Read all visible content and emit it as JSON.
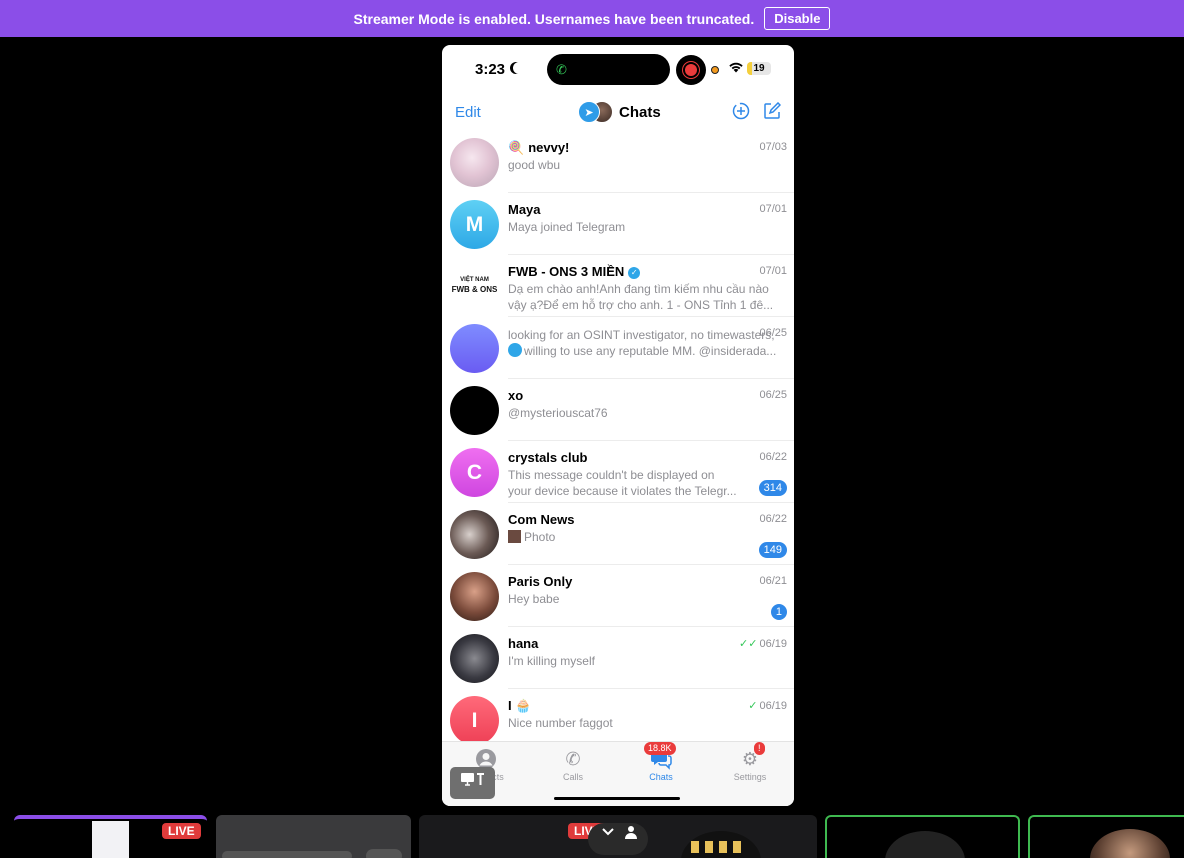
{
  "banner": {
    "text": "Streamer Mode is enabled. Usernames have been truncated.",
    "button": "Disable"
  },
  "status": {
    "time": "3:23",
    "battery": "19",
    "battery_level": 0.19
  },
  "nav": {
    "edit": "Edit",
    "title": "Chats"
  },
  "chats": [
    {
      "name": "nevvy!",
      "name_prefix": "🍭",
      "date": "07/03",
      "preview": [
        "good wbu"
      ],
      "avatar": "photo-pastel",
      "badge": ""
    },
    {
      "name": "Maya",
      "date": "07/01",
      "preview": [
        "Maya joined Telegram"
      ],
      "avatar_letter": "M",
      "avatar": "cyan",
      "badge": ""
    },
    {
      "name": "FWB - ONS 3 MIỀN",
      "verified": true,
      "date": "07/01",
      "preview": [
        "Dạ em chào anh!Anh đang tìm kiếm nhu cầu nào",
        "vậy ạ?Để em hỗ trợ cho anh. 1 - ONS Tỉnh 1 đê..."
      ],
      "avatar_text": "FWB & ONS",
      "avatar_small": "VIỆT NAM",
      "avatar": "fwb",
      "badge": ""
    },
    {
      "name": "",
      "date": "06/25",
      "preview": [
        "looking for an OSINT investigator, no timewasters,",
        "willing to use any reputable MM. @insiderada..."
      ],
      "avatar": "violet",
      "badge": ""
    },
    {
      "name": "xo",
      "date": "06/25",
      "preview": [
        "@mysteriouscat76"
      ],
      "avatar": "black",
      "badge": ""
    },
    {
      "name": "crystals club",
      "date": "06/22",
      "preview": [
        "This message couldn't be displayed on",
        "your device because it violates the Telegr..."
      ],
      "avatar_letter": "C",
      "avatar": "magenta",
      "badge": "314"
    },
    {
      "name": "Com News",
      "date": "06/22",
      "preview": [
        "Photo"
      ],
      "avatar": "photo-bw",
      "badge": "149"
    },
    {
      "name": "Paris Only",
      "date": "06/21",
      "preview": [
        "Hey babe"
      ],
      "avatar": "photo-warm",
      "badge": "1"
    },
    {
      "name": "hana",
      "date": "06/19",
      "read": "✓✓",
      "preview": [
        "I'm killing myself"
      ],
      "avatar": "photo-dark",
      "badge": ""
    },
    {
      "name": "I",
      "name_suffix": "🧁",
      "date": "06/19",
      "read": "✓",
      "preview": [
        "Nice number faggot"
      ],
      "avatar_letter": "I",
      "avatar": "red",
      "badge": ""
    }
  ],
  "tabs": [
    {
      "label": "Contacts",
      "icon": "person-icon"
    },
    {
      "label": "Calls",
      "icon": "phone-icon"
    },
    {
      "label": "Chats",
      "icon": "chat-bubbles-icon",
      "badge": "18.8K",
      "active": true
    },
    {
      "label": "Settings",
      "icon": "gear-icon",
      "badge": "!"
    }
  ],
  "thumbs": {
    "live": "LIVE"
  }
}
